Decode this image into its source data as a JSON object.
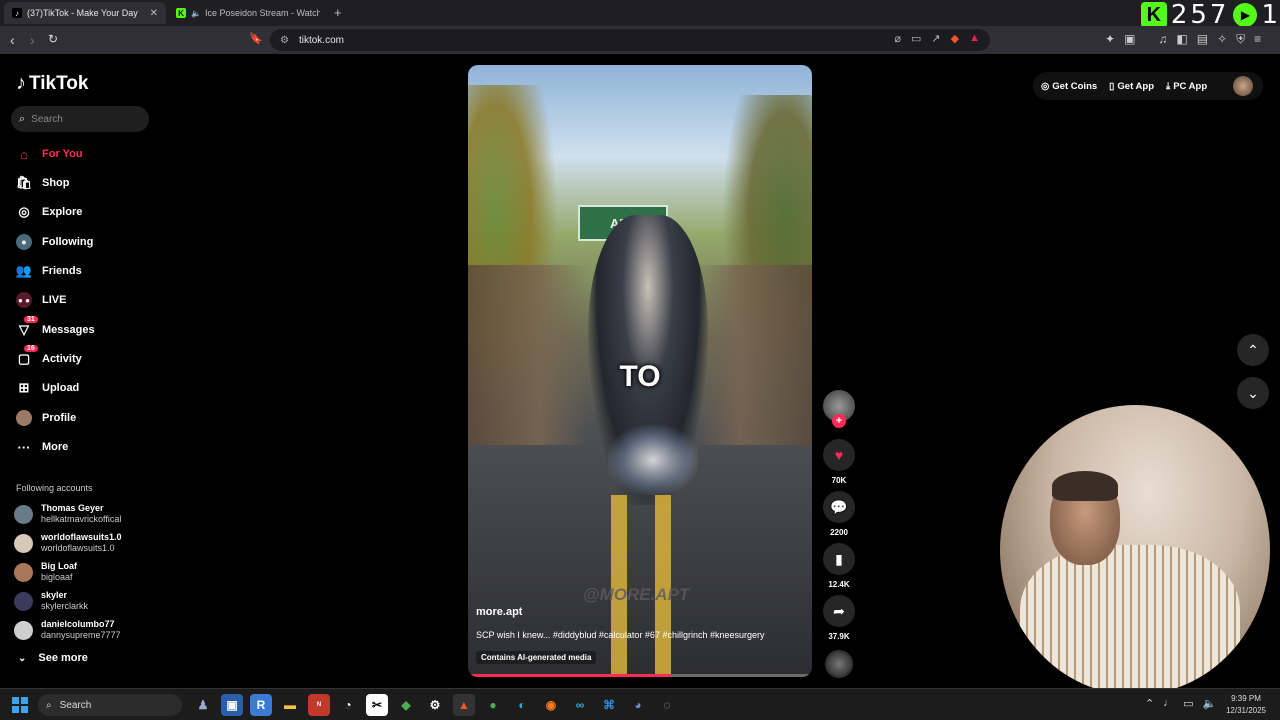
{
  "browser": {
    "tabs": [
      {
        "title": "(37)TikTok - Make Your Day",
        "active": true
      },
      {
        "title": "Ice Poseidon Stream - Watch Live",
        "active": false
      }
    ],
    "url": "tiktok.com",
    "kick_counter": "257",
    "kick_counter_cut": "1"
  },
  "tiktok": {
    "logo": "TikTok",
    "search_placeholder": "Search",
    "nav": [
      {
        "label": "For You",
        "icon": "home-icon",
        "active": true
      },
      {
        "label": "Shop",
        "icon": "shop-icon"
      },
      {
        "label": "Explore",
        "icon": "compass-icon"
      },
      {
        "label": "Following",
        "icon": "following-icon"
      },
      {
        "label": "Friends",
        "icon": "friends-icon"
      },
      {
        "label": "LIVE",
        "icon": "live-icon"
      },
      {
        "label": "Messages",
        "icon": "messages-icon",
        "badge": "31"
      },
      {
        "label": "Activity",
        "icon": "activity-icon",
        "badge": "16"
      },
      {
        "label": "Upload",
        "icon": "upload-icon"
      },
      {
        "label": "Profile",
        "icon": "profile-icon"
      },
      {
        "label": "More",
        "icon": "more-icon"
      }
    ],
    "following_header": "Following accounts",
    "accounts": [
      {
        "name": "Thomas Geyer",
        "handle": "hellkatmavrickoffical"
      },
      {
        "name": "worldoflawsuits1.0",
        "handle": "worldoflawsuits1.0"
      },
      {
        "name": "Big Loaf",
        "handle": "bigloaaf"
      },
      {
        "name": "skyler",
        "handle": "skylerclarkk"
      },
      {
        "name": "danielcolumbo77",
        "handle": "dannysupreme7777"
      }
    ],
    "see_more": "See more",
    "top_right": {
      "coins": "Get Coins",
      "app": "Get App",
      "pc": "PC App"
    }
  },
  "video": {
    "sign_text": "AEL",
    "caption_word": "TO",
    "watermark": "@MORE.APT",
    "author": "more.apt",
    "description": "SCP wish I knew... #diddyblud #calculator #67 #chillgrinch #kneesurgery",
    "ai_label": "Contains AI-generated media",
    "progress": 0.59,
    "likes": "70K",
    "comments": "2200",
    "saves": "12.4K",
    "shares": "37.9K"
  },
  "taskbar": {
    "search": "Search",
    "time": "9:39 PM",
    "date": "12/31/2025"
  },
  "colors": {
    "accent": "#fe2c55",
    "kick": "#53fc18"
  }
}
